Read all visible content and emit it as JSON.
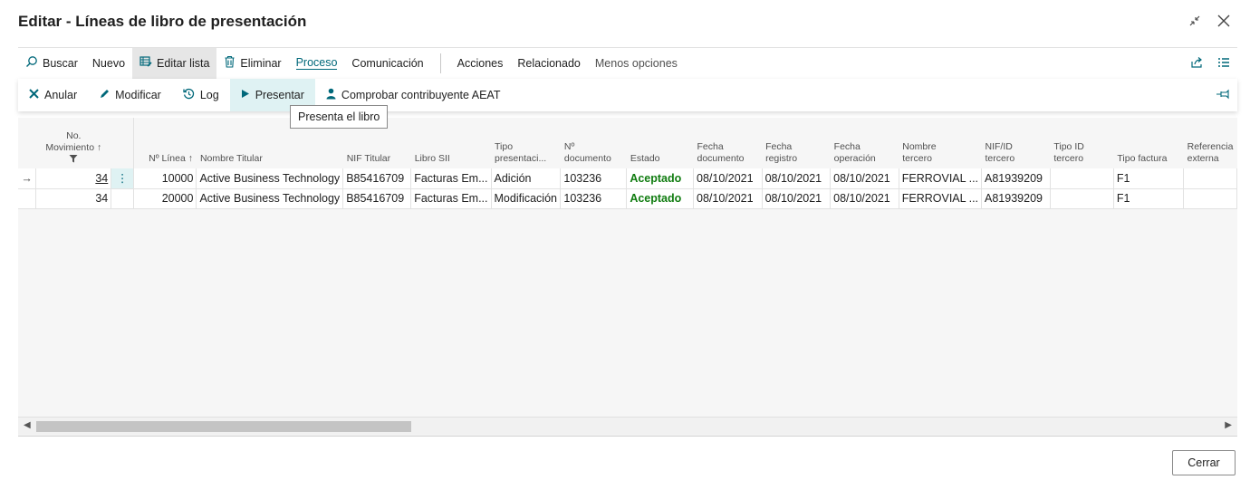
{
  "window": {
    "title": "Editar - Líneas de libro de presentación"
  },
  "actionbar": {
    "items": [
      {
        "label": "Buscar",
        "icon": "search-icon"
      },
      {
        "label": "Nuevo"
      },
      {
        "label": "Editar lista",
        "icon": "edit-list-icon"
      },
      {
        "label": "Eliminar",
        "icon": "trash-icon"
      },
      {
        "label": "Proceso"
      },
      {
        "label": "Comunicación"
      },
      {
        "label": "Acciones"
      },
      {
        "label": "Relacionado"
      },
      {
        "label": "Menos opciones"
      }
    ]
  },
  "subbar": {
    "items": [
      {
        "label": "Anular",
        "icon": "x-icon"
      },
      {
        "label": "Modificar",
        "icon": "pencil-icon"
      },
      {
        "label": "Log",
        "icon": "history-icon"
      },
      {
        "label": "Presentar",
        "icon": "play-icon"
      },
      {
        "label": "Comprobar contribuyente AEAT",
        "icon": "person-icon"
      }
    ]
  },
  "tooltip": "Presenta el libro",
  "table": {
    "columns": {
      "no_mov_line1": "No.",
      "no_mov_line2": "Movimiento",
      "linea": "Nº Línea",
      "nombre_titular": "Nombre Titular",
      "nif_titular": "NIF Titular",
      "libro_sii": "Libro SII",
      "tipo_pres_1": "Tipo",
      "tipo_pres_2": "presentaci...",
      "n_doc_1": "Nº",
      "n_doc_2": "documento",
      "estado": "Estado",
      "fecha_doc_1": "Fecha",
      "fecha_doc_2": "documento",
      "fecha_reg_1": "Fecha",
      "fecha_reg_2": "registro",
      "fecha_op_1": "Fecha",
      "fecha_op_2": "operación",
      "nombre_terc_1": "Nombre",
      "nombre_terc_2": "tercero",
      "nif_terc_1": "NIF/ID",
      "nif_terc_2": "tercero",
      "tipo_id_1": "Tipo ID",
      "tipo_id_2": "tercero",
      "tipo_factura": "Tipo factura",
      "ref_ext_1": "Referencia",
      "ref_ext_2": "externa"
    },
    "rows": [
      {
        "mov": "34",
        "linea": "10000",
        "nombre_titular": "Active Business Technology",
        "nif_titular": "B85416709",
        "libro_sii": "Facturas Em...",
        "tipo": "Adición",
        "n_doc": "103236",
        "estado": "Aceptado",
        "fecha_doc": "08/10/2021",
        "fecha_reg": "08/10/2021",
        "fecha_op": "08/10/2021",
        "nombre_tercero": "FERROVIAL ...",
        "nif_tercero": "A81939209",
        "tipo_id": "",
        "tipo_factura": "F1",
        "ref_ext": ""
      },
      {
        "mov": "34",
        "linea": "20000",
        "nombre_titular": "Active Business Technology",
        "nif_titular": "B85416709",
        "libro_sii": "Facturas Em...",
        "tipo": "Modificación",
        "n_doc": "103236",
        "estado": "Aceptado",
        "fecha_doc": "08/10/2021",
        "fecha_reg": "08/10/2021",
        "fecha_op": "08/10/2021",
        "nombre_tercero": "FERROVIAL ...",
        "nif_tercero": "A81939209",
        "tipo_id": "",
        "tipo_factura": "F1",
        "ref_ext": ""
      }
    ]
  },
  "footer": {
    "close_label": "Cerrar"
  },
  "colors": {
    "accent": "#00687a",
    "status_ok": "#107c10",
    "selected_bg": "#dff2f3"
  }
}
